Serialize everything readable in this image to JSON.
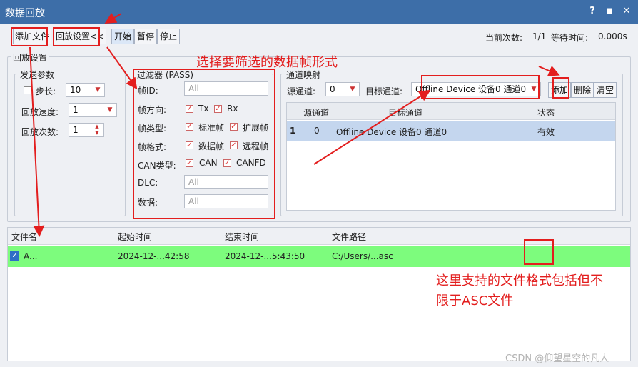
{
  "window": {
    "title": "数据回放",
    "help": "?",
    "minimize": "■",
    "close": "✕"
  },
  "toolbar": {
    "add_file": "添加文件",
    "replay_settings": "回放设置<<",
    "start": "开始",
    "pause": "暂停",
    "stop": "停止"
  },
  "status": {
    "count_label": "当前次数:",
    "count_value": "1/1",
    "wait_label": "等待时间:",
    "wait_value": "0.000s"
  },
  "replay_settings_title": "回放设置",
  "send_params": {
    "title": "发送参数",
    "step_label": "步长:",
    "step_value": "10",
    "speed_label": "回放速度:",
    "speed_value": "1",
    "times_label": "回放次数:",
    "times_value": "1"
  },
  "filter": {
    "title": "过滤器 (PASS)",
    "frame_id_label": "帧ID:",
    "frame_id_placeholder": "All",
    "dir_label": "帧方向:",
    "dir_tx": "Tx",
    "dir_rx": "Rx",
    "type_label": "帧类型:",
    "type_std": "标准帧",
    "type_ext": "扩展帧",
    "format_label": "帧格式:",
    "format_data": "数据帧",
    "format_remote": "远程帧",
    "can_label": "CAN类型:",
    "can_can": "CAN",
    "can_canfd": "CANFD",
    "dlc_label": "DLC:",
    "dlc_placeholder": "All",
    "data_label": "数据:",
    "data_placeholder": "All"
  },
  "mapping": {
    "title": "通道映射",
    "src_label": "源通道:",
    "src_value": "0",
    "dst_label": "目标通道:",
    "dst_value": "Offline Device 设备0 通道0",
    "add": "添加",
    "delete": "删除",
    "clear": "清空",
    "columns": [
      "源通道",
      "目标通道",
      "状态"
    ],
    "rows": [
      {
        "index": "1",
        "src": "0",
        "dst": "Offline Device 设备0 通道0",
        "state": "有效"
      }
    ]
  },
  "files": {
    "columns": [
      "文件名",
      "起始时间",
      "结束时间",
      "文件路径"
    ],
    "rows": [
      {
        "name": "A...",
        "start": "2024-12-...42:58",
        "end": "2024-12-...5:43:50",
        "path": "C:/Users/...asc"
      }
    ]
  },
  "annotations": {
    "filter_note": "选择要筛选的数据帧形式",
    "format_note_line1": "这里支持的文件格式包括但不",
    "format_note_line2": "限于ASC文件"
  },
  "watermark": "CSDN @仰望星空的凡人",
  "colors": {
    "titlebar": "#3d6ea8",
    "selected_row": "#7dfc7d",
    "annotation": "#e31e1e",
    "panel": "#eef0f4"
  }
}
